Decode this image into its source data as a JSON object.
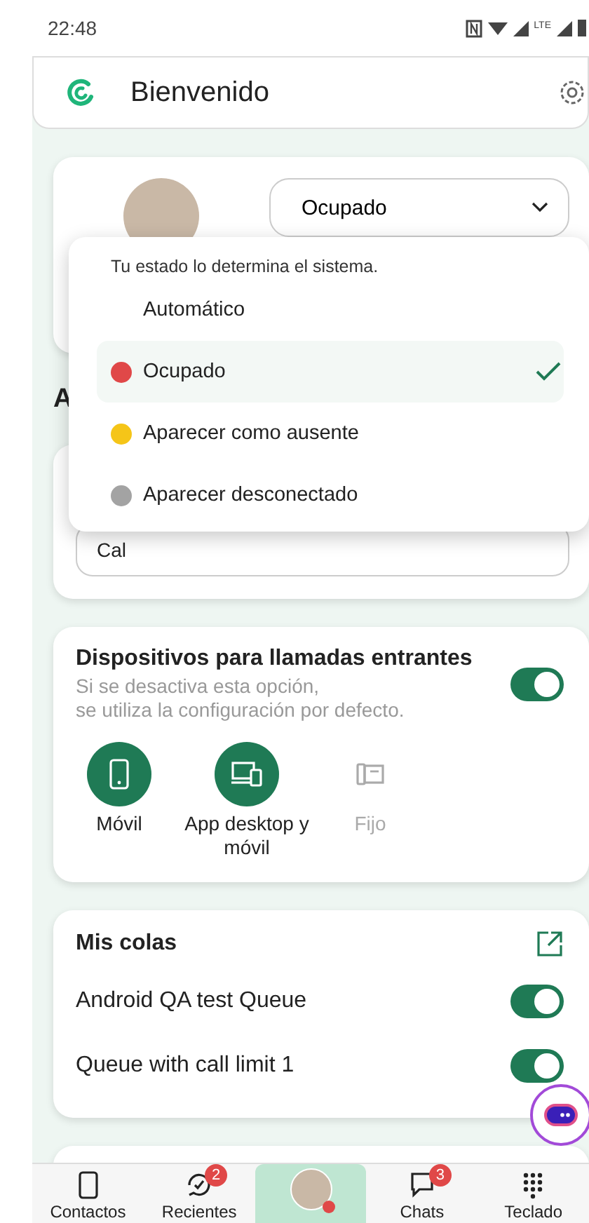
{
  "status_bar": {
    "time": "22:48",
    "network": "LTE"
  },
  "header": {
    "title": "Bienvenido"
  },
  "profile": {
    "status_dropdown": {
      "value": "Ocupado",
      "expanded": true
    }
  },
  "status_menu": {
    "hint": "Tu estado lo determina el sistema.",
    "options": [
      {
        "label": "Automático",
        "selected": false
      },
      {
        "label": "Ocupado",
        "selected": true,
        "color": "#e04848"
      },
      {
        "label": "Aparecer como ausente",
        "selected": false,
        "color": "#f5c518"
      },
      {
        "label": "Aparecer desconectado",
        "selected": false,
        "color": "#a3a3a3"
      }
    ]
  },
  "covered_section": {
    "heading": "A",
    "field_value": "Cal"
  },
  "devices": {
    "title": "Dispositivos para llamadas entrantes",
    "description": "Si se desactiva esta opción,\nse utiliza la configuración por defecto.",
    "on": true,
    "options": [
      {
        "label": "Móvil",
        "kind": "mobile",
        "selected": true
      },
      {
        "label": "App desktop y móvil",
        "kind": "desktop",
        "selected": true
      },
      {
        "label": "Fijo",
        "kind": "deskphone",
        "selected": false
      }
    ]
  },
  "queues": {
    "title": "Mis colas",
    "items": [
      {
        "name": "Android QA test Queue",
        "on": true
      },
      {
        "name": "Queue with call limit 1",
        "on": true
      }
    ]
  },
  "nav": {
    "items": [
      {
        "kind": "contacts",
        "label": "Contactos",
        "selected": false
      },
      {
        "kind": "recents",
        "label": "Recientes",
        "badge": "2",
        "selected": false
      },
      {
        "kind": "profile",
        "selected": true
      },
      {
        "kind": "chats",
        "label": "Chats",
        "badge": "3",
        "selected": false
      },
      {
        "kind": "keypad",
        "label": "Teclado",
        "selected": false
      }
    ]
  }
}
